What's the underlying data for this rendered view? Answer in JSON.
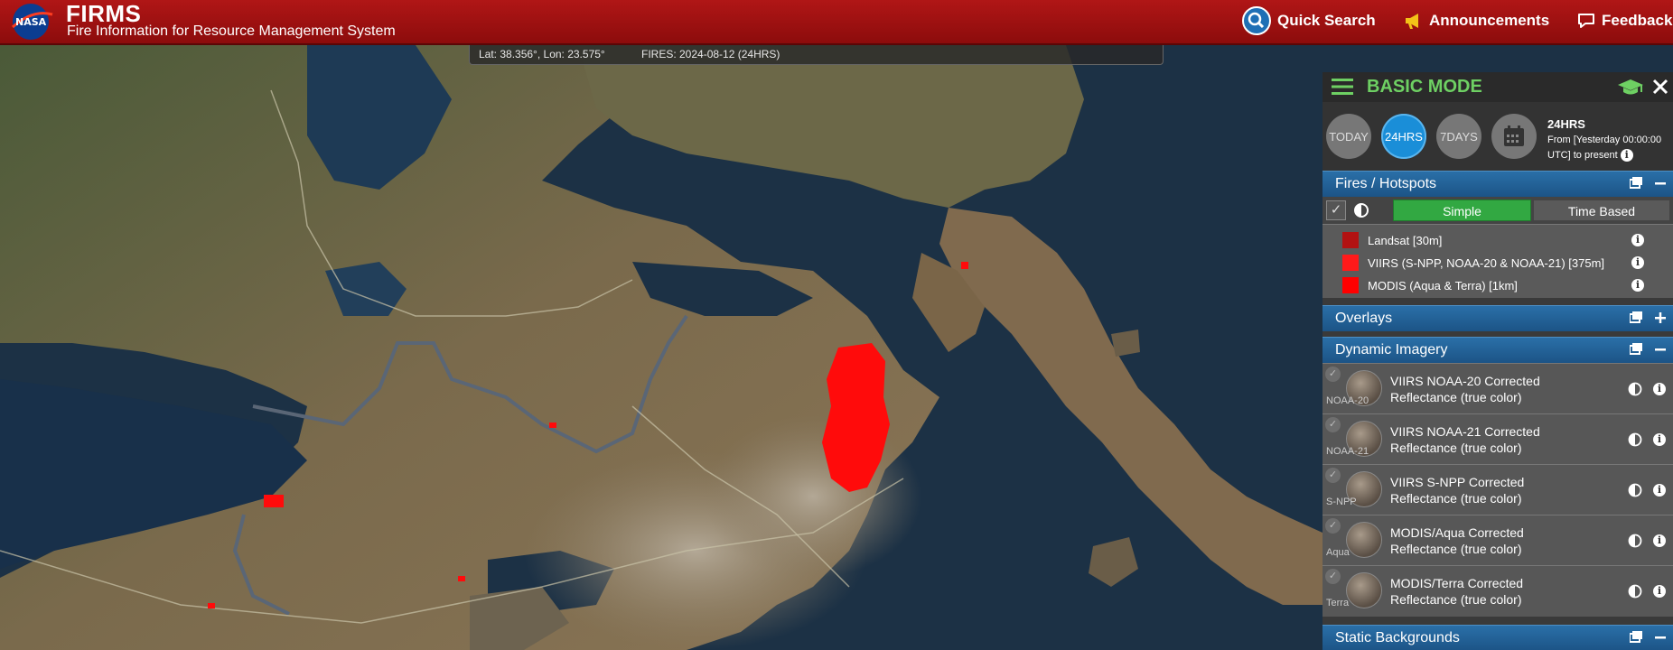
{
  "header": {
    "logo_text": "NASA",
    "app_name": "FIRMS",
    "app_subtitle": "Fire Information for Resource Management System",
    "quick_search": "Quick Search",
    "announcements": "Announcements",
    "feedback": "Feedback",
    "brand_color": "#a80f0f"
  },
  "status": {
    "coords": "Lat: 38.356°, Lon: 23.575°",
    "fires": "FIRES: 2024-08-12 (24HRS)"
  },
  "panel": {
    "mode_title": "BASIC MODE",
    "time_buttons": [
      {
        "label": "TODAY",
        "active": false
      },
      {
        "label": "24HRS",
        "active": true
      },
      {
        "label": "7DAYS",
        "active": false
      }
    ],
    "range_title": "24HRS",
    "range_desc": "From [Yesterday 00:00:00 UTC] to present",
    "sections": {
      "fires": "Fires / Hotspots",
      "overlays": "Overlays",
      "dynamic": "Dynamic Imagery",
      "static": "Static Backgrounds"
    },
    "modes": {
      "simple": "Simple",
      "time_based": "Time Based"
    },
    "legend": [
      {
        "label": "Landsat [30m]",
        "color": "#b21212"
      },
      {
        "label": "VIIRS (S-NPP, NOAA-20 & NOAA-21) [375m]",
        "color": "#ff1a1a"
      },
      {
        "label": "MODIS (Aqua & Terra) [1km]",
        "color": "#ff0000"
      }
    ],
    "imagery": [
      {
        "sat": "NOAA-20",
        "name": "VIIRS NOAA-20 Corrected Reflectance (true color)"
      },
      {
        "sat": "NOAA-21",
        "name": "VIIRS NOAA-21 Corrected Reflectance (true color)"
      },
      {
        "sat": "S-NPP",
        "name": "VIIRS S-NPP Corrected Reflectance (true color)"
      },
      {
        "sat": "Aqua",
        "name": "MODIS/Aqua Corrected Reflectance (true color)"
      },
      {
        "sat": "Terra",
        "name": "MODIS/Terra Corrected Reflectance (true color)"
      }
    ]
  }
}
